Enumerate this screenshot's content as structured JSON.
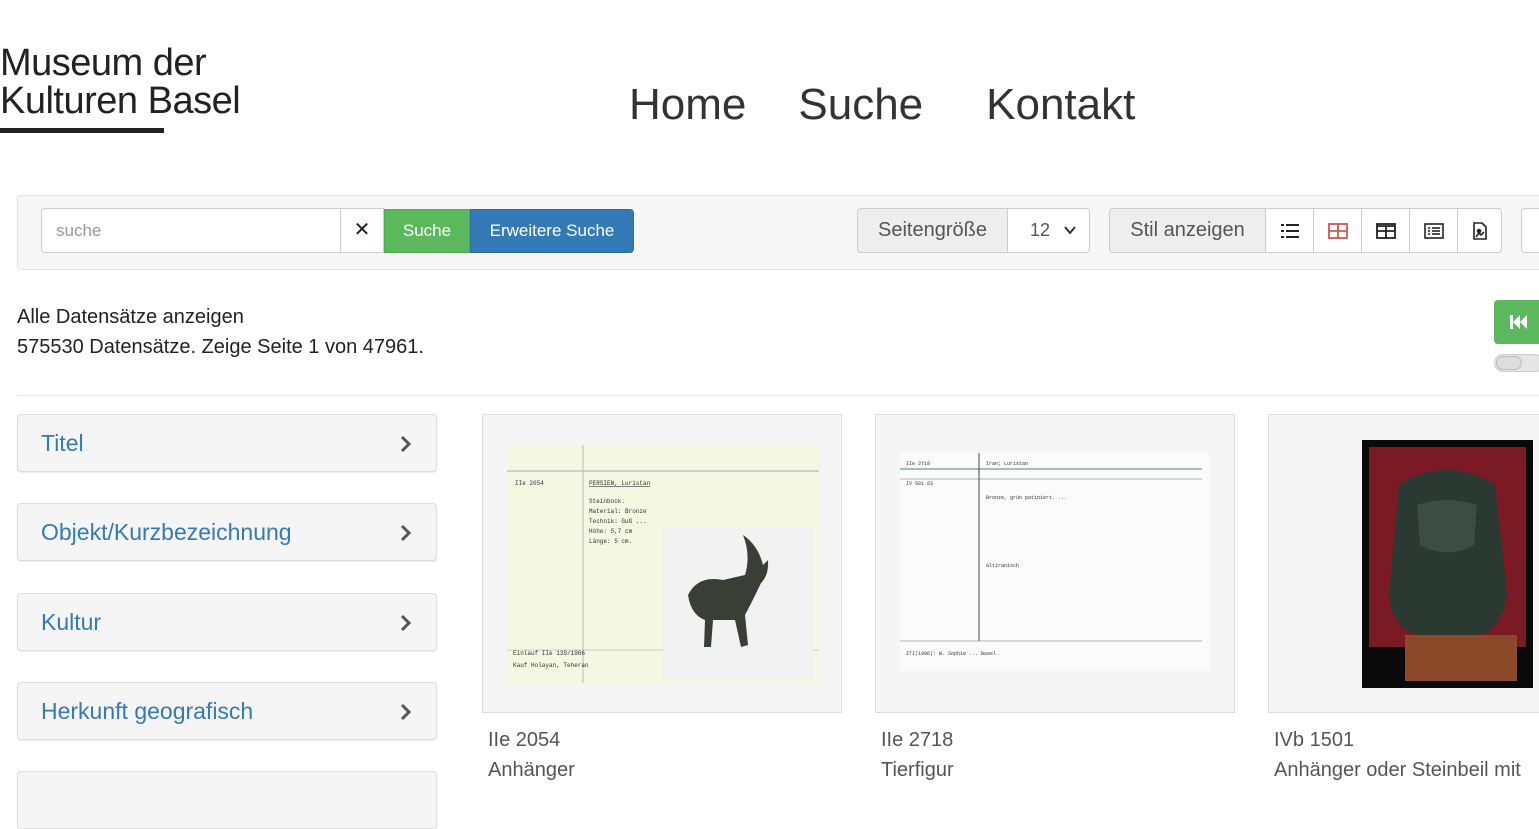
{
  "header": {
    "logo_line1": "Museum der",
    "logo_line2": "Kulturen Basel",
    "nav": [
      "Home",
      "Suche",
      "Kontakt"
    ]
  },
  "toolbar": {
    "search_placeholder": "suche",
    "clear_label": "✕",
    "search_label": "Suche",
    "advanced_label": "Erweitere Suche",
    "pagesize_label": "Seitengröße",
    "pagesize_value": "12",
    "style_label": "Stil anzeigen",
    "style_buttons": [
      "list-icon",
      "grid-icon",
      "table-grid-icon",
      "detail-list-icon",
      "document-image-icon"
    ],
    "accent_color": "#d9534f"
  },
  "results": {
    "show_all": "Alle Datensätze anzeigen",
    "summary": "575530 Datensätze. Zeige Seite 1 von 47961."
  },
  "facets": [
    "Titel",
    "Objekt/Kurzbezeichnung",
    "Kultur",
    "Herkunft geografisch"
  ],
  "cards": [
    {
      "id": "IIe 2054",
      "title": "Anhänger",
      "card_header_left": "IIe 2054",
      "card_header_right": "PERSIEN, Luristan",
      "card_line1": "Steinbock.",
      "card_line2": "Material: Bronze",
      "card_line3": "Technik: Guß ...",
      "card_line4": "Höhe: 5,7 cm",
      "card_line5": "Länge: 5 cm.",
      "card_foot1": "Einlauf IIe 139/1966",
      "card_foot2": "Kauf Holayan, Teheran"
    },
    {
      "id": "IIe 2718",
      "title": "Tierfigur",
      "card_header_left": "IIe 2718",
      "card_header_right": "Iran; Luristan",
      "card_subid": "IV 501 63",
      "card_line1": "Bronze, grün patiniert. ...",
      "card_line2": "altiranisch",
      "card_foot1": "ZTI(1996): W. Sophie ... Basel"
    },
    {
      "id": "IVb 1501",
      "title": "Anhänger oder Steinbeil mit"
    }
  ],
  "colors": {
    "link": "#337ab7",
    "success": "#5cb85c",
    "primary": "#337ab7"
  }
}
